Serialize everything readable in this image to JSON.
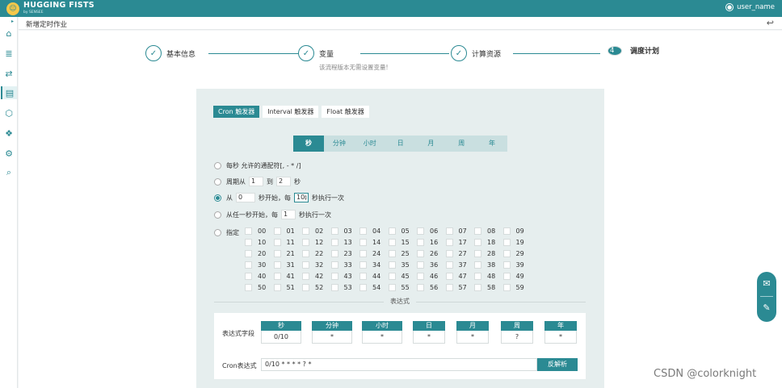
{
  "app": {
    "brand_name": "HUGGING FISTS",
    "brand_sub": "by SENSEE",
    "user_name": "user_name"
  },
  "breadcrumb": {
    "title": "新增定时作业"
  },
  "steps": [
    {
      "label": "基本信息",
      "state": "done"
    },
    {
      "label": "变量",
      "state": "done",
      "note": "该流程版本无需设置变量!"
    },
    {
      "label": "计算资源",
      "state": "done"
    },
    {
      "label": "调度计划",
      "state": "current",
      "number": "4"
    }
  ],
  "trigger_tabs": [
    "Cron 触发器",
    "Interval 触发器",
    "Float 触发器"
  ],
  "unit_tabs": [
    "秒",
    "分钟",
    "小时",
    "日",
    "月",
    "周",
    "年"
  ],
  "options": {
    "every": {
      "text": "每秒 允许的通配符[, - * /]"
    },
    "range": {
      "prefix": "周期从",
      "from": "1",
      "mid": "到",
      "to": "2",
      "suffix": "秒"
    },
    "from_start": {
      "prefix": "从",
      "start": "0",
      "mid": "秒开始，每",
      "step": "10",
      "suffix": "秒执行一次"
    },
    "any_start": {
      "prefix": "从任一秒开始，每",
      "step": "1",
      "suffix": "秒执行一次"
    },
    "specify": {
      "label": "指定"
    }
  },
  "seconds": [
    "00",
    "01",
    "02",
    "03",
    "04",
    "05",
    "06",
    "07",
    "08",
    "09",
    "10",
    "11",
    "12",
    "13",
    "14",
    "15",
    "16",
    "17",
    "18",
    "19",
    "20",
    "21",
    "22",
    "23",
    "24",
    "25",
    "26",
    "27",
    "28",
    "29",
    "30",
    "31",
    "32",
    "33",
    "34",
    "35",
    "36",
    "37",
    "38",
    "39",
    "40",
    "41",
    "42",
    "43",
    "44",
    "45",
    "46",
    "47",
    "48",
    "49",
    "50",
    "51",
    "52",
    "53",
    "54",
    "55",
    "56",
    "57",
    "58",
    "59"
  ],
  "expression": {
    "title": "表达式",
    "fields_label": "表达式字段",
    "fields": [
      {
        "name": "秒",
        "value": "0/10"
      },
      {
        "name": "分钟",
        "value": "*"
      },
      {
        "name": "小时",
        "value": "*"
      },
      {
        "name": "日",
        "value": "*"
      },
      {
        "name": "月",
        "value": "*"
      },
      {
        "name": "周",
        "value": "?"
      },
      {
        "name": "年",
        "value": "*"
      }
    ],
    "cron_label": "Cron表达式",
    "cron_value": "0/10 * * * * ? *",
    "parse_button": "反解析"
  },
  "watermark": "CSDN @colorknight",
  "colors": {
    "accent": "#2b8a93",
    "panel": "#e6eeee"
  }
}
